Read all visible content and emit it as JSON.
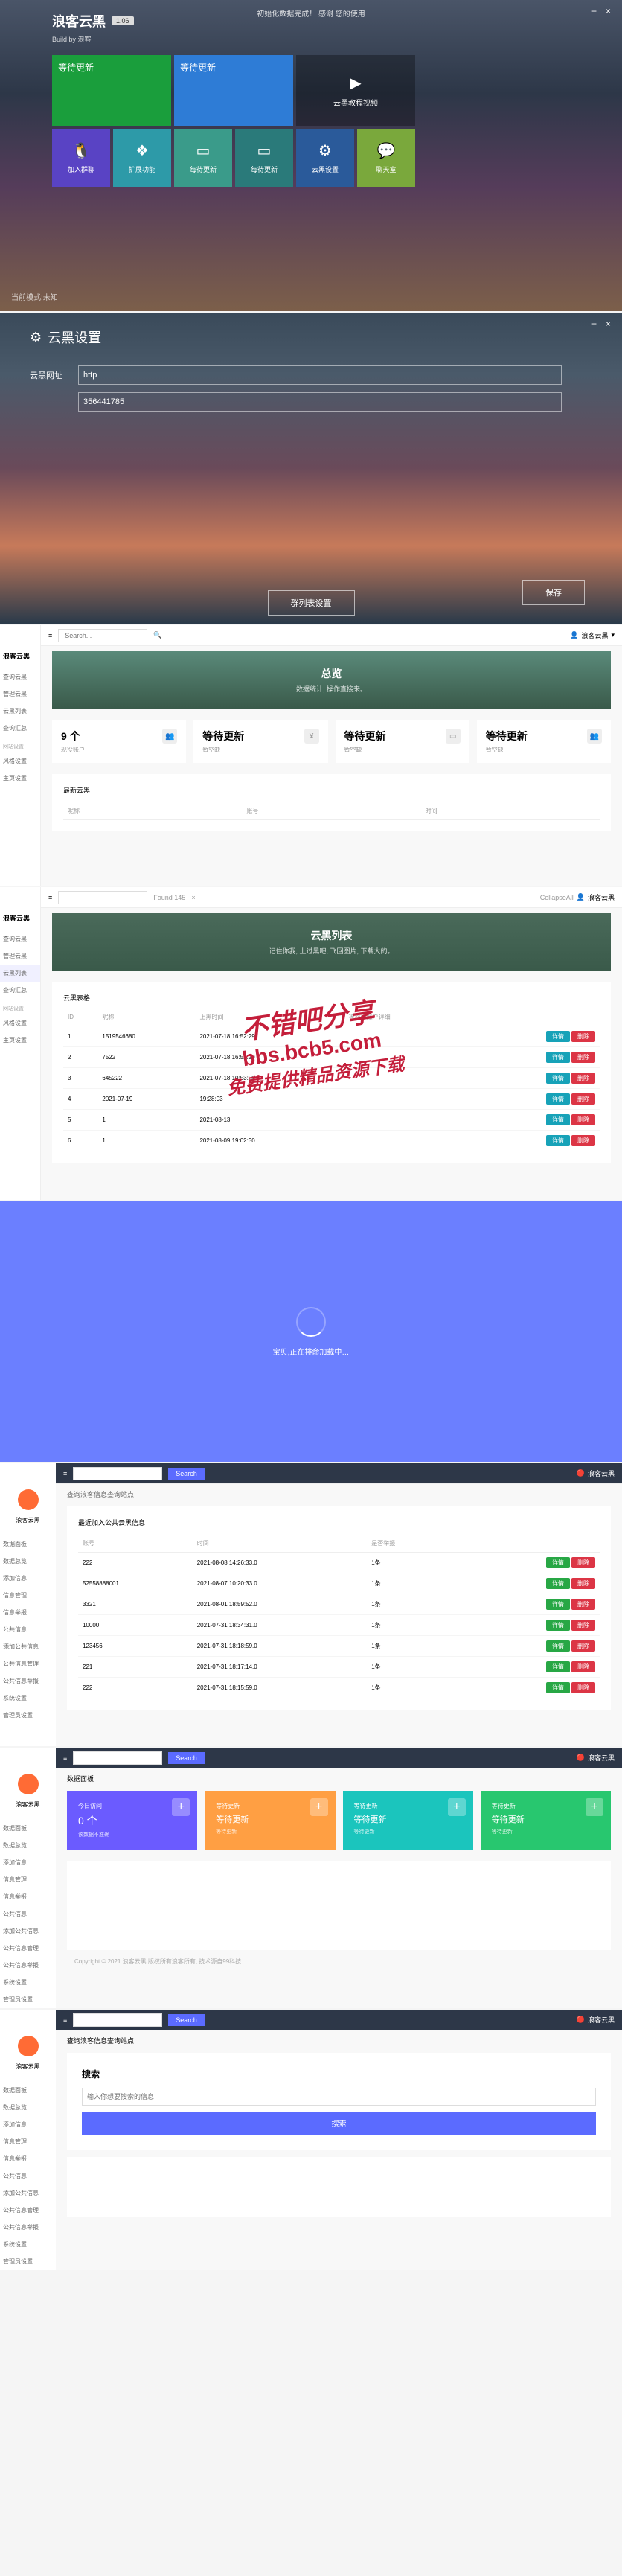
{
  "panel1": {
    "title": "浪客云黑",
    "version": "1.06",
    "subtitle": "Build by 浪客",
    "topMsg": "初始化数据完成！ 感谢   您的使用",
    "tiles": {
      "update1": "等待更新",
      "update2": "等待更新",
      "video": "云黑教程视频",
      "joinGroup": "加入群聊",
      "expand": "扩展功能",
      "update3": "每待更新",
      "update4": "每待更新",
      "settings": "云黑设置",
      "chat": "聊天室"
    },
    "modeLabel": "当前模式:未知"
  },
  "panel2": {
    "title": "云黑设置",
    "urlLabel": "云黑网址",
    "urlValue": "http",
    "codeLabel": "",
    "codeValue": "356441785",
    "groupBtn": "群列表设置",
    "saveBtn": "保存"
  },
  "dash1": {
    "brand": "浪客云黑",
    "searchPlaceholder": "Search...",
    "userLabel": "浪客云黑",
    "sidebar": {
      "items": [
        "查询云黑",
        "管理云黑",
        "云黑列表",
        "查询汇总"
      ],
      "section": "网站设置",
      "items2": [
        "风格设置",
        "主页设置"
      ]
    },
    "hero": {
      "title": "总览",
      "sub": "数据统计,  操作直接来。"
    },
    "stats": [
      {
        "val": "9 个",
        "lbl": "现役账户"
      },
      {
        "val": "等待更新",
        "lbl": "暂空缺"
      },
      {
        "val": "等待更新",
        "lbl": "暂空缺"
      },
      {
        "val": "等待更新",
        "lbl": "暂空缺"
      }
    ],
    "chartLabel": "最新云黑",
    "cols": [
      "呢称",
      "账号",
      "时间"
    ]
  },
  "dash2": {
    "brand": "浪客云黑",
    "foundLabel": "Found 145",
    "collapseLabel": "CollapseAll",
    "hero": {
      "title": "云黑列表",
      "sub": "记住你我,  上过黑吧,  飞回图片, 下载大的。"
    },
    "sectionLabel": "云黑表格",
    "cols": [
      "ID",
      "昵称",
      "上黑时间",
      "被操作账户详细",
      ""
    ],
    "rows": [
      {
        "id": "1",
        "name": "1519546680",
        "time": "2021-07-18 16:52:29"
      },
      {
        "id": "2",
        "name": "7522",
        "time": "2021-07-18 16:52:29"
      },
      {
        "id": "3",
        "name": "645222",
        "time": "2021-07-18 10:53:20"
      },
      {
        "id": "4",
        "name": "2021-07-19",
        "time": "19:28:03"
      },
      {
        "id": "5",
        "name": "1",
        "time": "2021-08-13"
      },
      {
        "id": "6",
        "name": "1",
        "time": "2021-08-09 19:02:30"
      }
    ],
    "btnDetail": "详情",
    "btnDelete": "删除"
  },
  "loading": {
    "text": "宝贝,正在排命加载中…"
  },
  "dash3": {
    "userLabel": "浪客云黑",
    "breadcrumb": "查询浪客信息查询站点",
    "subhead": "最近加入公共云黑信息",
    "cols": [
      "账号",
      "时间",
      "是否举报",
      ""
    ],
    "rows": [
      {
        "acc": "222",
        "time": "2021-08-08 14:26:33.0",
        "rep": "1条"
      },
      {
        "acc": "52558888001",
        "time": "2021-08-07 10:20:33.0",
        "rep": "1条"
      },
      {
        "acc": "3321",
        "time": "2021-08-01 18:59:52.0",
        "rep": "1条"
      },
      {
        "acc": "10000",
        "time": "2021-07-31 18:34:31.0",
        "rep": "1条"
      },
      {
        "acc": "123456",
        "time": "2021-07-31 18:18:59.0",
        "rep": "1条"
      },
      {
        "acc": "221",
        "time": "2021-07-31 18:17:14.0",
        "rep": "1条"
      },
      {
        "acc": "222",
        "time": "2021-07-31 18:15:59.0",
        "rep": "1条"
      }
    ],
    "btnDetail": "详情",
    "btnDelete": "删除",
    "sidebar": [
      "数据面板",
      "数据总览",
      "添加信息",
      "信息管理",
      "信息举报",
      "公共信息",
      "添加公共信息",
      "公共信息管理",
      "公共信息举报",
      "系统设置",
      "管理员设置"
    ]
  },
  "dash4": {
    "breadcrumb": "数据面板",
    "stats": [
      {
        "title": "今日访问",
        "val": "0 个",
        "sub": "该数据不准确"
      },
      {
        "title": "等待更新",
        "val": "等待更新",
        "sub": "等待更新"
      },
      {
        "title": "等待更新",
        "val": "等待更新",
        "sub": "等待更新"
      },
      {
        "title": "等待更新",
        "val": "等待更新",
        "sub": "等待更新"
      }
    ],
    "footer": "Copyright © 2021 浪客云黑 版权所有浪客所有,  技术源自99科技"
  },
  "dash5": {
    "breadcrumb": "查询浪客信息查询站点",
    "searchTitle": "搜索",
    "searchPlaceholder": "输入你想要搜索的信息",
    "searchBtn": "搜索"
  },
  "watermark": {
    "line1": "不错吧分享",
    "line2": "bbs.bcb5.com",
    "line3": "免费提供精品资源下载"
  }
}
